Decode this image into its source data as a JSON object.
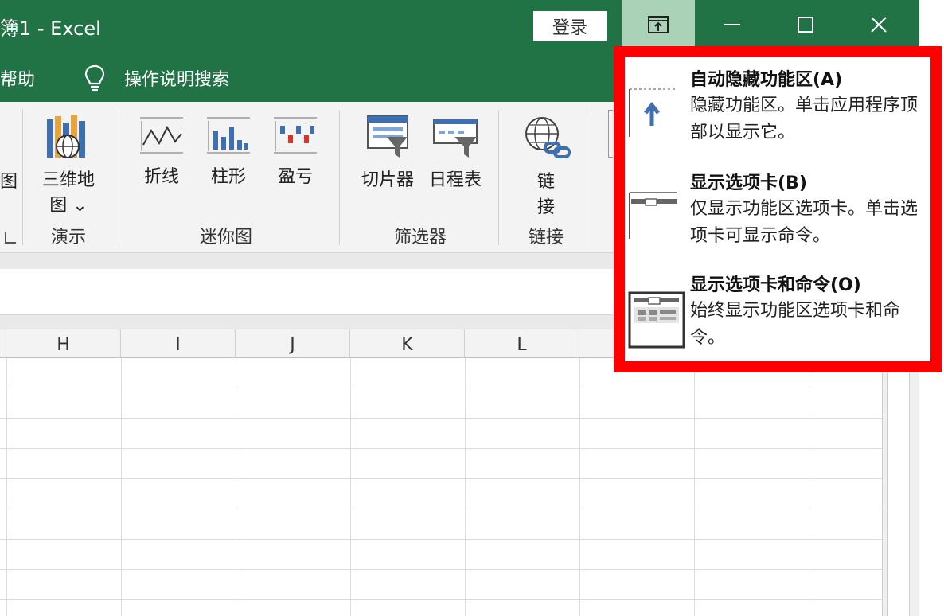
{
  "titlebar": {
    "title": "簿1  -  Excel",
    "login_label": "登录"
  },
  "tabs": {
    "help_label": "帮助",
    "search_label": "操作说明搜索"
  },
  "ribbon": {
    "map_3d_label_line1": "三维地",
    "map_3d_label_line2": "图 ⌄",
    "cut_left_label": "图",
    "line_label": "折线",
    "column_label": "柱形",
    "winloss_label": "盈亏",
    "slicer_label": "切片器",
    "timeline_label": "日程表",
    "link_label_line1": "链",
    "link_label_line2": "接",
    "groups": {
      "demo": "演示",
      "sparklines": "迷你图",
      "filters": "筛选器",
      "links": "链接"
    }
  },
  "columns": [
    "H",
    "I",
    "J",
    "K",
    "L"
  ],
  "ribbon_display_menu": {
    "options": [
      {
        "title": "自动隐藏功能区(A)",
        "desc": "隐藏功能区。单击应用程序顶部以显示它。"
      },
      {
        "title": "显示选项卡(B)",
        "desc": "仅显示功能区选项卡。单击选项卡可显示命令。"
      },
      {
        "title": "显示选项卡和命令(O)",
        "desc": "始终显示功能区选项卡和命令。"
      }
    ]
  },
  "colors": {
    "excel_green": "#217346",
    "highlight_red": "#ff0000",
    "ribbon_opt_active": "#a9d2b6"
  }
}
